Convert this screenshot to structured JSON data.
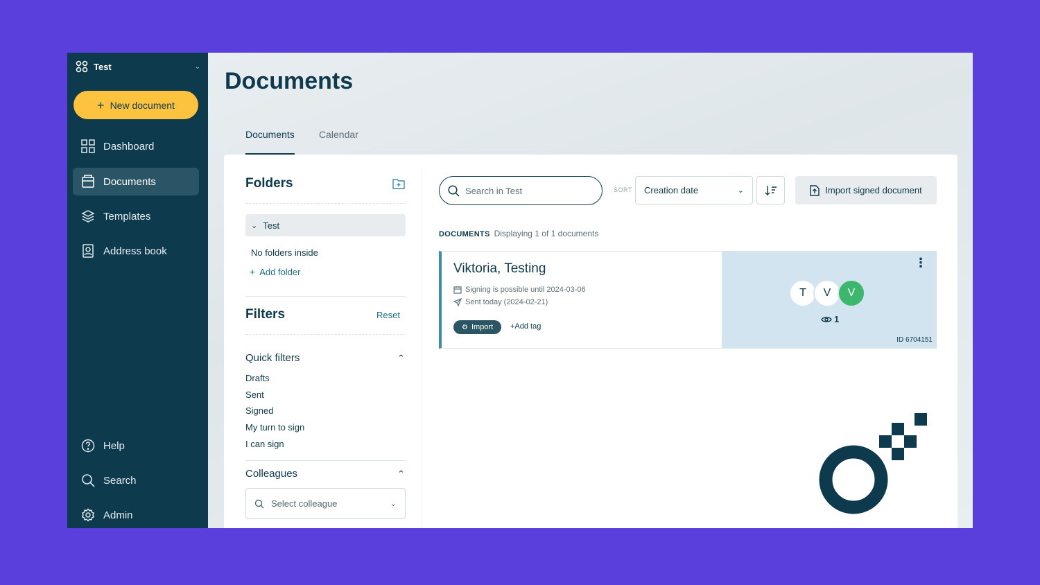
{
  "workspace": {
    "name": "Test"
  },
  "sidebar": {
    "new_document": "New document",
    "items": [
      {
        "label": "Dashboard"
      },
      {
        "label": "Documents"
      },
      {
        "label": "Templates"
      },
      {
        "label": "Address book"
      }
    ],
    "bottom_items": [
      {
        "label": "Help"
      },
      {
        "label": "Search"
      },
      {
        "label": "Admin"
      }
    ]
  },
  "header": {
    "title": "Documents",
    "tabs": [
      {
        "label": "Documents"
      },
      {
        "label": "Calendar"
      }
    ]
  },
  "folders": {
    "title": "Folders",
    "current": "Test",
    "empty_text": "No folders inside",
    "add_folder": "Add folder"
  },
  "filters": {
    "title": "Filters",
    "reset": "Reset",
    "quick_filters_title": "Quick filters",
    "quick_filters": [
      "Drafts",
      "Sent",
      "Signed",
      "My turn to sign",
      "I can sign"
    ],
    "colleagues_title": "Colleagues",
    "colleague_placeholder": "Select colleague"
  },
  "toolbar": {
    "search_placeholder": "Search in Test",
    "sort_label": "SORT",
    "sort_value": "Creation date",
    "import_label": "Import signed document"
  },
  "documents": {
    "heading": "DOCUMENTS",
    "count_text": "Displaying 1 of 1 documents",
    "items": [
      {
        "title": "Viktoria, Testing",
        "signing_until": "Signing is possible until 2024-03-06",
        "sent": "Sent today (2024-02-21)",
        "tag": "Import",
        "add_tag": "+Add tag",
        "avatars": [
          "T",
          "V",
          "V"
        ],
        "views": "1",
        "id": "ID 6704151"
      }
    ]
  },
  "colors": {
    "sidebar_bg": "#0d3a4c",
    "accent_yellow": "#fdc23e",
    "frame_purple": "#5b3fdc",
    "signed_green": "#3cb86e"
  }
}
